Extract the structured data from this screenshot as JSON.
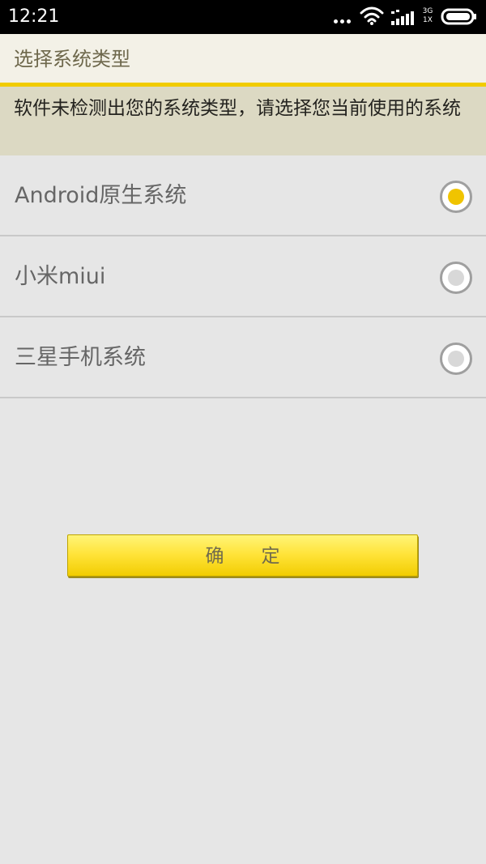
{
  "status_bar": {
    "time": "12:21",
    "network_type": "3G\n1X",
    "icons": [
      "more-dots-icon",
      "wifi-icon",
      "signal-icon",
      "battery-icon"
    ]
  },
  "header": {
    "title": "选择系统类型",
    "accent_color": "#f1cc00"
  },
  "notice": {
    "text": "软件未检测出您的系统类型，请选择您当前使用的系统"
  },
  "options": [
    {
      "label": "Android原生系统",
      "selected": true
    },
    {
      "label": "小米miui",
      "selected": false
    },
    {
      "label": "三星手机系统",
      "selected": false
    }
  ],
  "actions": {
    "confirm_label": "确定"
  },
  "colors": {
    "status_background": "#000000",
    "title_background": "#f3f1e7",
    "notice_background": "#dcd9c3",
    "content_background": "#e6e6e6",
    "selected_radio": "#f0c400",
    "button_yellow": "#ffe338"
  }
}
